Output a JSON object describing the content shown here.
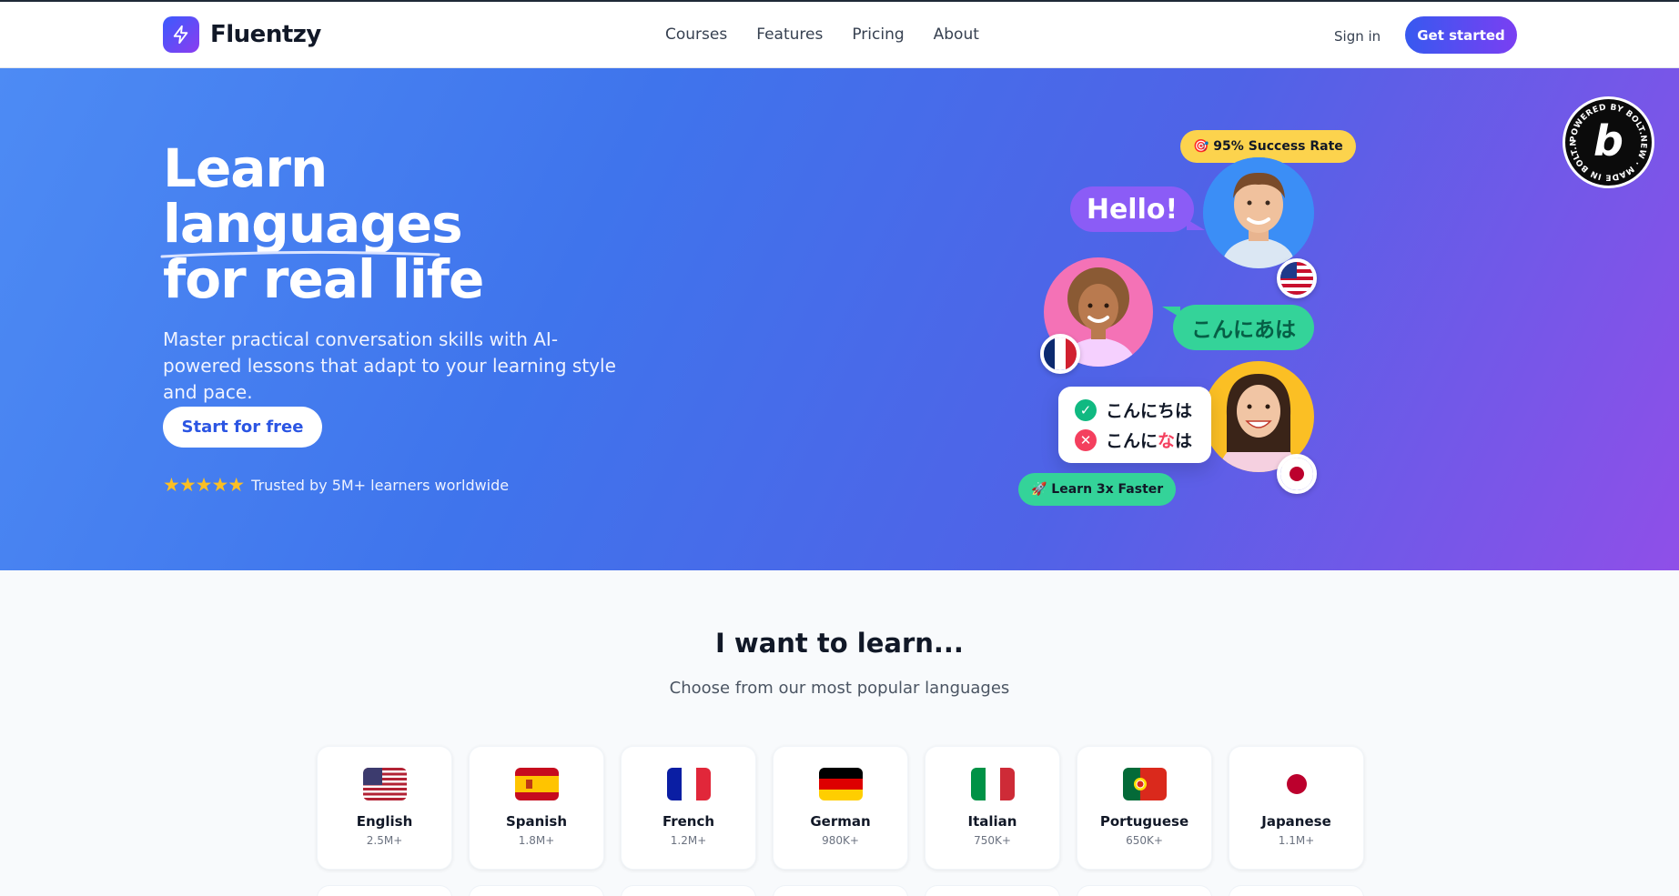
{
  "brand": {
    "name": "Fluentzy",
    "logo_icon": "lightning-bolt-icon",
    "accent": "#4f46e5"
  },
  "nav": {
    "items": [
      {
        "label": "Courses"
      },
      {
        "label": "Features"
      },
      {
        "label": "Pricing"
      },
      {
        "label": "About"
      }
    ]
  },
  "header": {
    "signin_label": "Sign in",
    "cta_label": "Get started"
  },
  "hero": {
    "title_line1": "Learn",
    "title_line2": "languages",
    "title_line3": "for real life",
    "subtitle": "Master practical conversation skills with AI-powered lessons that adapt to your learning style and pace.",
    "cta_label": "Start for free",
    "stars": "★★★★★",
    "trust_text": "Trusted by 5M+ learners worldwide",
    "badge_success": "🎯 95% Success Rate",
    "badge_faster": "🚀 Learn 3x Faster",
    "bubble_hello": "Hello!",
    "bubble_jp": "こんにあは",
    "quiz_correct": "こんにちは",
    "quiz_wrong_prefix": "こんに",
    "quiz_wrong_highlight": "な",
    "quiz_wrong_suffix": "は",
    "colors": {
      "success_badge": "#fcd34d",
      "faster_badge": "#34d399",
      "hello_bubble": "#8b5cf6"
    }
  },
  "bolt_badge": {
    "ring_text": "POWERED BY BOLT.NEW · MADE IN BOLT.NEW ·",
    "letter": "b"
  },
  "languages": {
    "title": "I want to learn...",
    "subtitle": "Choose from our most popular languages",
    "items": [
      {
        "name": "English",
        "count": "2.5M+",
        "flag": "us-flag-icon"
      },
      {
        "name": "Spanish",
        "count": "1.8M+",
        "flag": "spain-flag-icon"
      },
      {
        "name": "French",
        "count": "1.2M+",
        "flag": "france-flag-icon"
      },
      {
        "name": "German",
        "count": "980K+",
        "flag": "germany-flag-icon"
      },
      {
        "name": "Italian",
        "count": "750K+",
        "flag": "italy-flag-icon"
      },
      {
        "name": "Portuguese",
        "count": "650K+",
        "flag": "portugal-flag-icon"
      },
      {
        "name": "Japanese",
        "count": "1.1M+",
        "flag": "japan-flag-icon"
      }
    ]
  }
}
